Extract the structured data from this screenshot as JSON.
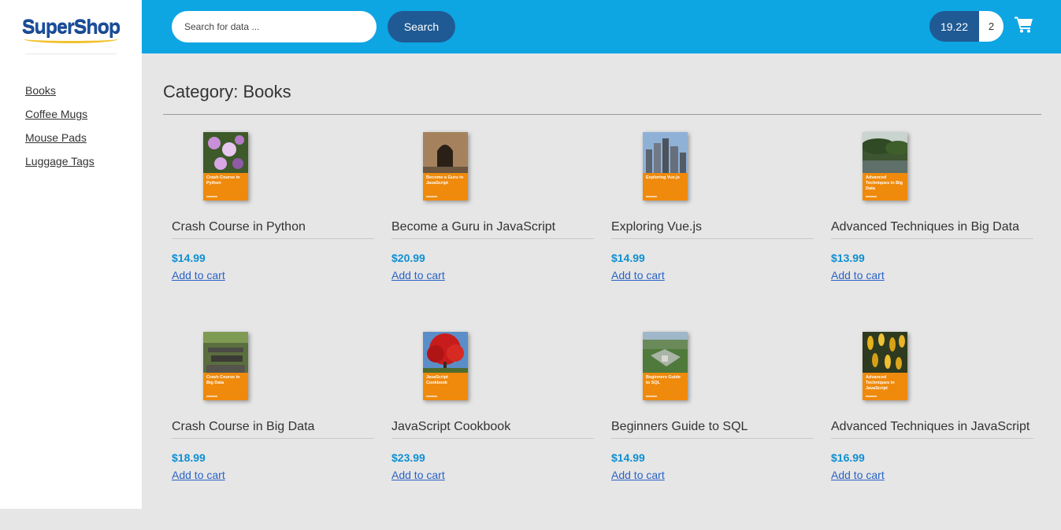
{
  "brand": {
    "logo_text": "SuperShop"
  },
  "search": {
    "placeholder": "Search for data ...",
    "button_label": "Search"
  },
  "cart": {
    "total": "19.22",
    "count": "2",
    "icon": "shopping-cart-icon"
  },
  "sidebar": {
    "items": [
      {
        "label": "Books"
      },
      {
        "label": "Coffee Mugs"
      },
      {
        "label": "Mouse Pads"
      },
      {
        "label": "Luggage Tags"
      }
    ]
  },
  "main": {
    "title": "Category: Books"
  },
  "products": [
    {
      "name": "Crash Course in Python",
      "price": "$14.99",
      "action": "Add to cart",
      "cover_title": "Crash Course in Python"
    },
    {
      "name": "Become a Guru in JavaScript",
      "price": "$20.99",
      "action": "Add to cart",
      "cover_title": "Become a Guru in JavaScript"
    },
    {
      "name": "Exploring Vue.js",
      "price": "$14.99",
      "action": "Add to cart",
      "cover_title": "Exploring Vue.js"
    },
    {
      "name": "Advanced Techniques in Big Data",
      "price": "$13.99",
      "action": "Add to cart",
      "cover_title": "Advanced Techniques in Big Data"
    },
    {
      "name": "Crash Course in Big Data",
      "price": "$18.99",
      "action": "Add to cart",
      "cover_title": "Crash Course in Big Data"
    },
    {
      "name": "JavaScript Cookbook",
      "price": "$23.99",
      "action": "Add to cart",
      "cover_title": "JavaScript Cookbook"
    },
    {
      "name": "Beginners Guide to SQL",
      "price": "$14.99",
      "action": "Add to cart",
      "cover_title": "Beginners Guide to SQL"
    },
    {
      "name": "Advanced Techniques in JavaScript",
      "price": "$16.99",
      "action": "Add to cart",
      "cover_title": "Advanced Techniques in JavaScript"
    }
  ],
  "colors": {
    "header_bg": "#0ea5e3",
    "button_bg": "#1f5a94",
    "price": "#0f8fd1",
    "link": "#2a62c6",
    "cover": "#ef8a0c",
    "logo": "#1b4f9e"
  }
}
